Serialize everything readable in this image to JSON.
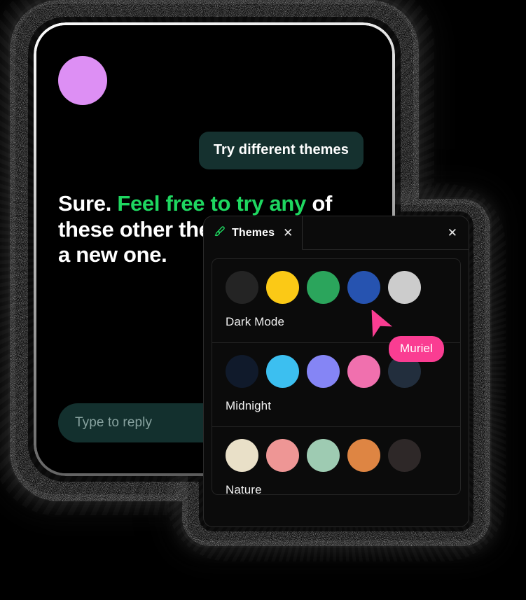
{
  "app": {
    "avatar": {
      "icon": "avatar-circle",
      "color": "#dd8ff4"
    }
  },
  "conversation": {
    "user_message": "Try different themes",
    "assistant_message": {
      "prefix": "Sure. ",
      "highlight": "Feel free to try any",
      "suffix": " of these other themes or create a new one.",
      "visible_text": "Sure. Feel free to try any of these other the    new one.",
      "highlight_color": "#1ed760"
    },
    "reply_input": {
      "placeholder": "Type to reply",
      "value": ""
    }
  },
  "themes_panel": {
    "tab": {
      "icon": "paintbrush-icon",
      "label": "Themes",
      "close_glyph": "✕"
    },
    "window_close_glyph": "✕",
    "themes": [
      {
        "name": "Dark Mode",
        "swatches": [
          "#242424",
          "#fbc916",
          "#2ba55c",
          "#2653b0",
          "#cccccc"
        ]
      },
      {
        "name": "Midnight",
        "swatches": [
          "#101a2b",
          "#3cbff0",
          "#8585f5",
          "#f070ae",
          "#222e3d"
        ]
      },
      {
        "name": "Nature",
        "swatches": [
          "#e9e0c8",
          "#ee9695",
          "#9ecbb2",
          "#de8543",
          "#2e2828"
        ]
      }
    ]
  },
  "cursor": {
    "label": "Muriel",
    "color": "#fa3d92"
  }
}
